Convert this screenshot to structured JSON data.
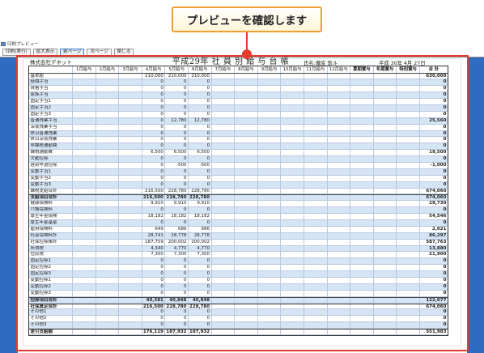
{
  "callout": {
    "text": "プレビューを確認します"
  },
  "window": {
    "title": "印刷プレビュー"
  },
  "toolbar": {
    "buttons": [
      {
        "label": "印刷(実行)"
      },
      {
        "label": "拡大表示"
      },
      {
        "label": "前ページ"
      },
      {
        "label": "次ページ"
      },
      {
        "label": "閉じる"
      }
    ]
  },
  "colors": {
    "callout_border": "#f0a030",
    "marker": "#e33b2e",
    "preview_background": "#2f6bbf",
    "row_stripe": "#d5e5f6"
  },
  "report": {
    "company": "株式会社デネット",
    "title": "平成29年 社 員 別 給 与 台 帳",
    "employee": "氏名:徹底 悠斗",
    "date": "平成 30年 4月 27日",
    "columns": [
      "1月給与",
      "2月給与",
      "3月給与",
      "4月給与",
      "5月給与",
      "6月給与",
      "7月給与",
      "8月給与",
      "9月給与",
      "10月給与",
      "11月給与",
      "12月給与",
      "夏期賞与",
      "冬期賞与",
      "特別賞与",
      "合 計"
    ],
    "rows": [
      {
        "label": "基本給",
        "cells": {
          "4月給与": "210,000",
          "5月給与": "210,000",
          "6月給与": "210,000",
          "合 計": "630,000"
        }
      },
      {
        "label": "役職手当",
        "cells": {
          "4月給与": "0",
          "5月給与": "0",
          "6月給与": "0",
          "合 計": "0"
        }
      },
      {
        "label": "資格手当",
        "cells": {
          "4月給与": "0",
          "5月給与": "0",
          "6月給与": "0",
          "合 計": "0"
        }
      },
      {
        "label": "家族手当",
        "cells": {
          "4月給与": "0",
          "5月給与": "0",
          "6月給与": "0",
          "合 計": "0"
        }
      },
      {
        "label": "固定手当1",
        "cells": {
          "4月給与": "0",
          "5月給与": "0",
          "6月給与": "0",
          "合 計": "0"
        }
      },
      {
        "label": "固定手当2",
        "cells": {
          "4月給与": "0",
          "5月給与": "0",
          "6月給与": "0",
          "合 計": "0"
        }
      },
      {
        "label": "固定手当3",
        "cells": {
          "4月給与": "0",
          "5月給与": "0",
          "6月給与": "0",
          "合 計": "0"
        }
      },
      {
        "label": "普通残業手当",
        "cells": {
          "4月給与": "0",
          "5月給与": "12,780",
          "6月給与": "12,780",
          "合 計": "25,560"
        }
      },
      {
        "label": "深夜残業手当",
        "cells": {
          "4月給与": "0",
          "5月給与": "0",
          "6月給与": "0",
          "合 計": "0"
        }
      },
      {
        "label": "休日普通残業",
        "cells": {
          "4月給与": "0",
          "5月給与": "0",
          "6月給与": "0",
          "合 計": "0"
        }
      },
      {
        "label": "休日深夜残業",
        "cells": {
          "4月給与": "0",
          "5月給与": "0",
          "6月給与": "0",
          "合 計": "0"
        }
      },
      {
        "label": "非課税通勤費",
        "cells": {
          "4月給与": "0",
          "5月給与": "0",
          "6月給与": "0",
          "合 計": "0"
        }
      },
      {
        "label": "課税通勤費",
        "cells": {
          "4月給与": "6,500",
          "5月給与": "6,500",
          "6月給与": "6,500",
          "合 計": "19,500"
        }
      },
      {
        "label": "欠勤控除",
        "cells": {
          "4月給与": "0",
          "5月給与": "0",
          "6月給与": "0",
          "合 計": "0"
        }
      },
      {
        "label": "遅刻早退控除",
        "cells": {
          "4月給与": "0",
          "5月給与": "-500",
          "6月給与": "-500",
          "合 計": "-1,000"
        }
      },
      {
        "label": "変動手当1",
        "cells": {
          "4月給与": "0",
          "5月給与": "0",
          "6月給与": "0",
          "合 計": "0"
        }
      },
      {
        "label": "変動手当2",
        "cells": {
          "4月給与": "0",
          "5月給与": "0",
          "6月給与": "0",
          "合 計": "0"
        }
      },
      {
        "label": "変動手当3",
        "cells": {
          "4月給与": "0",
          "5月給与": "0",
          "6月給与": "0",
          "合 計": "0"
        }
      },
      {
        "label": "課税支給合計",
        "cells": {
          "4月給与": "216,500",
          "5月給与": "228,780",
          "6月給与": "228,780",
          "合 計": "674,060"
        }
      },
      {
        "label": "支給項目合計",
        "summary": true,
        "cells": {
          "4月給与": "216,500",
          "5月給与": "228,780",
          "6月給与": "228,780",
          "合 計": "674,060"
        }
      },
      {
        "label": "健康保険料",
        "cells": {
          "4月給与": "9,910",
          "5月給与": "9,910",
          "6月給与": "9,910",
          "合 計": "29,730"
        }
      },
      {
        "label": "介護保険料",
        "cells": {
          "4月給与": "0",
          "5月給与": "0",
          "6月給与": "0",
          "合 計": "0"
        }
      },
      {
        "label": "厚生年金保険",
        "cells": {
          "4月給与": "18,182",
          "5月給与": "18,182",
          "6月給与": "18,182",
          "合 計": "54,546"
        }
      },
      {
        "label": "厚生年金基金",
        "cells": {
          "4月給与": "0",
          "5月給与": "0",
          "6月給与": "0",
          "合 計": "0"
        }
      },
      {
        "label": "雇用保険料",
        "cells": {
          "4月給与": "649",
          "5月給与": "686",
          "6月給与": "686",
          "合 計": "2,021"
        }
      },
      {
        "label": "社会保険料計",
        "cells": {
          "4月給与": "28,741",
          "5月給与": "28,778",
          "6月給与": "28,778",
          "合 計": "86,297"
        }
      },
      {
        "label": "社保控除後計",
        "cells": {
          "4月給与": "187,759",
          "5月給与": "200,002",
          "6月給与": "200,002",
          "合 計": "587,763"
        }
      },
      {
        "label": "所得税",
        "cells": {
          "4月給与": "4,340",
          "5月給与": "4,770",
          "6月給与": "4,770",
          "合 計": "13,880"
        }
      },
      {
        "label": "住民税",
        "cells": {
          "4月給与": "7,300",
          "5月給与": "7,300",
          "6月給与": "7,300",
          "合 計": "21,900"
        }
      },
      {
        "label": "固定控除1",
        "cells": {
          "4月給与": "0",
          "5月給与": "0",
          "6月給与": "0",
          "合 計": "0"
        }
      },
      {
        "label": "固定控除2",
        "cells": {
          "4月給与": "0",
          "5月給与": "0",
          "6月給与": "0",
          "合 計": "0"
        }
      },
      {
        "label": "固定控除3",
        "cells": {
          "4月給与": "0",
          "5月給与": "0",
          "6月給与": "0",
          "合 計": "0"
        }
      },
      {
        "label": "変動控除1",
        "cells": {
          "4月給与": "0",
          "5月給与": "0",
          "6月給与": "0",
          "合 計": "0"
        }
      },
      {
        "label": "変動控除2",
        "cells": {
          "4月給与": "0",
          "5月給与": "0",
          "6月給与": "0",
          "合 計": "0"
        }
      },
      {
        "label": "変動控除3",
        "cells": {
          "4月給与": "0",
          "5月給与": "0",
          "6月給与": "0",
          "合 計": "0"
        }
      },
      {
        "label": "控除項目合計",
        "summary": true,
        "cells": {
          "4月給与": "40,381",
          "5月給与": "40,848",
          "6月給与": "40,848",
          "合 計": "122,077"
        }
      },
      {
        "label": "社保算定合計",
        "summary": true,
        "cells": {
          "4月給与": "216,500",
          "5月給与": "228,780",
          "6月給与": "228,780",
          "合 計": "674,060"
        }
      },
      {
        "label": "その他1",
        "cells": {
          "4月給与": "0",
          "5月給与": "0",
          "6月給与": "0",
          "合 計": "0"
        }
      },
      {
        "label": "その他2",
        "cells": {
          "4月給与": "0",
          "5月給与": "0",
          "6月給与": "0",
          "合 計": "0"
        }
      },
      {
        "label": "その他3",
        "cells": {
          "4月給与": "0",
          "5月給与": "0",
          "6月給与": "0",
          "合 計": "0"
        }
      },
      {
        "label": "差引支給額",
        "summary": true,
        "cells": {
          "4月給与": "176,119",
          "5月給与": "187,932",
          "6月給与": "187,932",
          "合 計": "551,983"
        }
      }
    ]
  }
}
